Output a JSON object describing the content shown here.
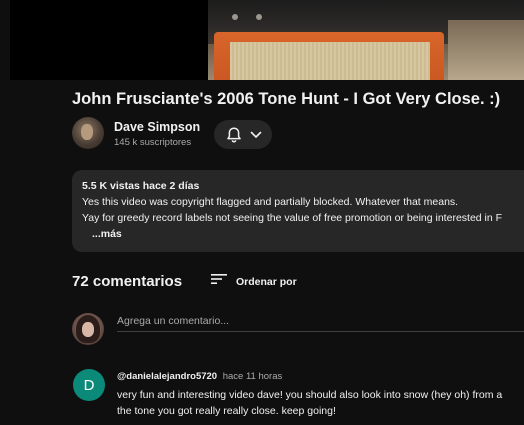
{
  "video": {
    "title": "John Frusciante's 2006 Tone Hunt - I Got Very Close. :)"
  },
  "channel": {
    "name": "Dave Simpson",
    "subscribers": "145 k suscriptores"
  },
  "description": {
    "meta": "5.5 K vistas  hace 2 días",
    "lines": [
      "Yes this video was copyright flagged and partially blocked. Whatever that means.",
      "Yay for greedy record labels not seeing the value of free promotion or being interested in F"
    ],
    "more": "...más"
  },
  "comments": {
    "count_label": "72 comentarios",
    "sort_label": "Ordenar por",
    "add_placeholder": "Agrega un comentario...",
    "items": [
      {
        "avatar_letter": "D",
        "avatar_color": "#0b8a7a",
        "author": "@danielalejandro5720",
        "time": "hace 11 horas",
        "lines": [
          "very fun and interesting video dave! you should also look into snow (hey oh) from a",
          "the tone you got really really close. keep going!"
        ]
      }
    ]
  },
  "icons": {
    "bell": "bell-icon",
    "chevron": "chevron-down-icon",
    "sort": "sort-icon"
  }
}
